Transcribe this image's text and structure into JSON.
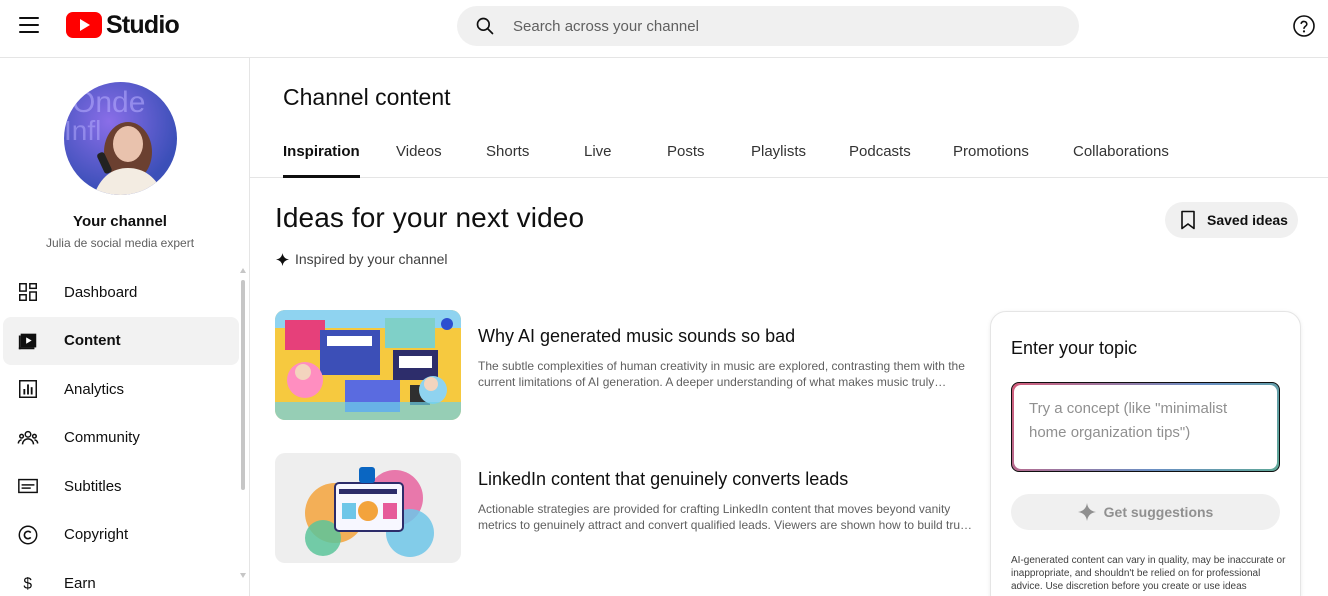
{
  "header": {
    "logo_text": "Studio",
    "search_placeholder": "Search across your channel"
  },
  "sidebar": {
    "channel_name": "Your channel",
    "channel_sub": "Julia de social media expert",
    "items": [
      {
        "label": "Dashboard",
        "icon": "dashboard-icon"
      },
      {
        "label": "Content",
        "icon": "content-icon",
        "active": true
      },
      {
        "label": "Analytics",
        "icon": "analytics-icon"
      },
      {
        "label": "Community",
        "icon": "community-icon"
      },
      {
        "label": "Subtitles",
        "icon": "subtitles-icon"
      },
      {
        "label": "Copyright",
        "icon": "copyright-icon"
      },
      {
        "label": "Earn",
        "icon": "earn-icon"
      }
    ]
  },
  "main": {
    "page_title": "Channel content",
    "tabs": [
      {
        "label": "Inspiration"
      },
      {
        "label": "Videos"
      },
      {
        "label": "Shorts"
      },
      {
        "label": "Live"
      },
      {
        "label": "Posts"
      },
      {
        "label": "Playlists"
      },
      {
        "label": "Podcasts"
      },
      {
        "label": "Promotions"
      },
      {
        "label": "Collaborations"
      }
    ],
    "section_title": "Ideas for your next video",
    "saved_ideas_label": "Saved ideas",
    "inspired_label": "Inspired by your channel",
    "ideas": [
      {
        "title": "Why AI generated music sounds so bad",
        "description": "The subtle complexities of human creativity in music are explored, contrasting them with the current limitations of AI generation. A deeper understanding of what makes music truly resonate is presented."
      },
      {
        "title": "LinkedIn content that genuinely converts leads",
        "description": "Actionable strategies are provided for crafting LinkedIn content that moves beyond vanity metrics to genuinely attract and convert qualified leads. Viewers are shown how to build trust and authority."
      }
    ]
  },
  "topic_panel": {
    "title": "Enter your topic",
    "input_placeholder": "Try a concept (like \"minimalist home organization tips\")",
    "button_label": "Get suggestions",
    "disclaimer": "AI-generated content can vary in quality, may be inaccurate or inappropriate, and shouldn't be relied on for professional advice. Use discretion before you create or use ideas"
  }
}
